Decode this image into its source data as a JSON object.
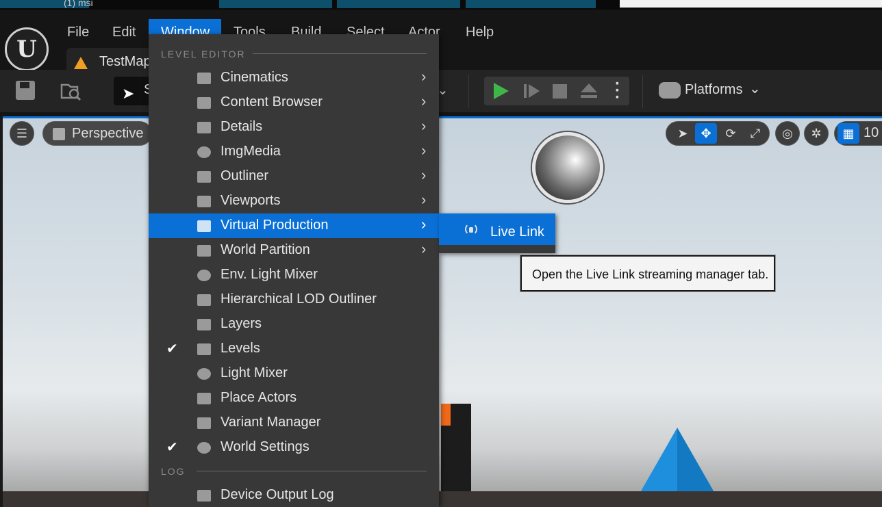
{
  "os": {
    "window_title": "(1) msi"
  },
  "menubar": {
    "items": [
      "File",
      "Edit",
      "Window",
      "Tools",
      "Build",
      "Select",
      "Actor",
      "Help"
    ],
    "active": "Window"
  },
  "tab": {
    "label": "TestMap"
  },
  "toolbar": {
    "mode_label": "S",
    "platforms_label": "Platforms"
  },
  "viewport": {
    "view_label": "Perspective",
    "grid_size": "10"
  },
  "window_menu": {
    "section_level_editor": "LEVEL EDITOR",
    "section_log": "LOG",
    "items": [
      {
        "label": "Cinematics",
        "icon": "clapper-icon",
        "submenu": true,
        "checked": false
      },
      {
        "label": "Content Browser",
        "icon": "folder-search-icon",
        "submenu": true,
        "checked": false
      },
      {
        "label": "Details",
        "icon": "pencil-icon",
        "submenu": true,
        "checked": false
      },
      {
        "label": "ImgMedia",
        "icon": "film-reel-icon",
        "submenu": true,
        "checked": false
      },
      {
        "label": "Outliner",
        "icon": "list-icon",
        "submenu": true,
        "checked": false
      },
      {
        "label": "Viewports",
        "icon": "grid-icon",
        "submenu": true,
        "checked": false
      },
      {
        "label": "Virtual Production",
        "icon": "person-frame-icon",
        "submenu": true,
        "checked": false,
        "highlighted": true
      },
      {
        "label": "World Partition",
        "icon": "grid-map-icon",
        "submenu": true,
        "checked": false
      },
      {
        "label": "Env. Light Mixer",
        "icon": "light-mixer-icon",
        "submenu": false,
        "checked": false
      },
      {
        "label": "Hierarchical LOD Outliner",
        "icon": "stack-icon",
        "submenu": false,
        "checked": false
      },
      {
        "label": "Layers",
        "icon": "layers-icon",
        "submenu": false,
        "checked": false
      },
      {
        "label": "Levels",
        "icon": "levels-icon",
        "submenu": false,
        "checked": true
      },
      {
        "label": "Light Mixer",
        "icon": "sun-icon",
        "submenu": false,
        "checked": false
      },
      {
        "label": "Place Actors",
        "icon": "cube-plus-icon",
        "submenu": false,
        "checked": false
      },
      {
        "label": "Variant Manager",
        "icon": "variant-icon",
        "submenu": false,
        "checked": false
      },
      {
        "label": "World Settings",
        "icon": "globe-icon",
        "submenu": false,
        "checked": true
      }
    ],
    "log_items": [
      {
        "label": "Device Output Log",
        "icon": "log-icon"
      }
    ]
  },
  "submenu": {
    "label": "Live Link",
    "icon": "broadcast-icon"
  },
  "tooltip": {
    "text": "Open the Live Link streaming manager tab."
  },
  "colors": {
    "accent": "#0a70d6",
    "menu_bg": "#383838",
    "play": "#3fb64a",
    "warning": "#f0a020"
  }
}
